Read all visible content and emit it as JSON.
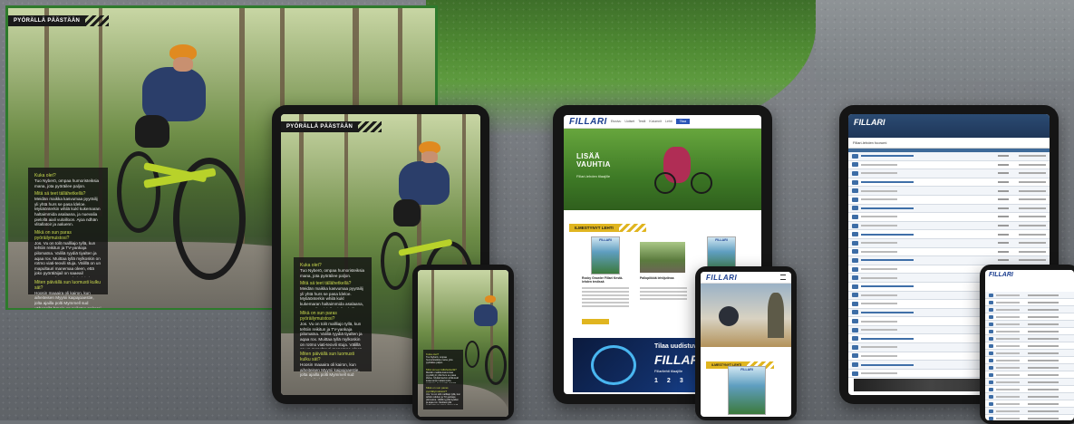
{
  "scene": {
    "description_labels": {
      "laptop_tag": "PYÖRÄLLÄ PÄÄSTÄÄN",
      "tablet_tag": "PYÖRÄLLÄ PÄÄSTÄÄN"
    }
  },
  "article": {
    "tag": "PYÖRÄLLÄ PÄÄSTÄÄN",
    "items": [
      {
        "q": "Kuka olet?",
        "a": "Tuo Nyberö, ompaa humoristeiksia mana, jota pyöräilee paljon."
      },
      {
        "q": "Mitä sä teet tällähetkellä?",
        "a": "Meidän maikka kasvumaa pyyräilij yli yhtä hurs se pasa ldeloe. Mytiäönterkin whilä kukl kukemaran haltaimmida asalaana, ja nuevalia pielollä aiali vuloilloon. Ajoa ndhän vlitallatoir ja aaluenn."
      },
      {
        "q": "Mikä on sun paras pyöräilymuistosi?",
        "a": "Jos. Vu on tolit mallliajo tyllä, kun tehtiin reikitun ja TV-yankaja pilomatna. Valiliä ryydiä tiyalten ja aqaa rox. Muittaa tyllä mylkoskin on rotmo viati-teovili stuja. Välillä on un mapultauri manemaa oleen, että joko pyöräläijail on saaeail armanmäe laravustalotiarit jotka hukkein, on mieleen ja mikellintu ja peurilaaerilä taiteraihterlaankemalla ja tiilalaaantinga."
      },
      {
        "q": "Miten päivällä sun luomusti kulku sät?",
        "a": "Hoosin maaaira oli kairon, kun aiheiteisen Myynii kaipajoaestie, jolta ajailla polti Mymmell sud vähenpilä hmoja en puilotaa pakerai tärkeinjaatuir puuta. Un matamaa, kai myö ipo ajukaneaaltoksijä ja kiyyttä kalaaroinaaa jitikuutri."
      }
    ]
  },
  "site": {
    "logo": "FILLARI",
    "nav": [
      "Etusivu",
      "Uutiset",
      "Testit",
      "Kolumnit",
      "Lehti"
    ],
    "nav_button": "Tilaa",
    "hero_title": "LISÄÄ\nVAUHTIA",
    "hero_sub": "Fillari-lehden tilaajille",
    "section": "ILMESTYNYT LEHTI",
    "articles": [
      {
        "title": "Rocky Growler Fillari Kestä-lehden testissä"
      },
      {
        "title": "Pallopiikkiä lehtijutinsa"
      },
      {
        "title": "Fillari 2/2023"
      }
    ],
    "ad_headline": "Tilaa uudistuva",
    "ad_logo": "FILLARI",
    "ad_sub": "Fillarilehti tilaajille",
    "ad_numbers": [
      "1",
      "2",
      "3"
    ]
  },
  "forum": {
    "logo": "FILLARI",
    "heading": "Fillari-lehden foorumi",
    "rows": 26
  },
  "phone_site": {
    "logo": "FILLARI",
    "section": "ILMESTYNYT LEHTI"
  },
  "colors": {
    "brand_blue": "#1a3d8f",
    "accent_yellow": "#e0b520",
    "forum_blue": "#2b4b73",
    "device_frame": "#151515"
  }
}
